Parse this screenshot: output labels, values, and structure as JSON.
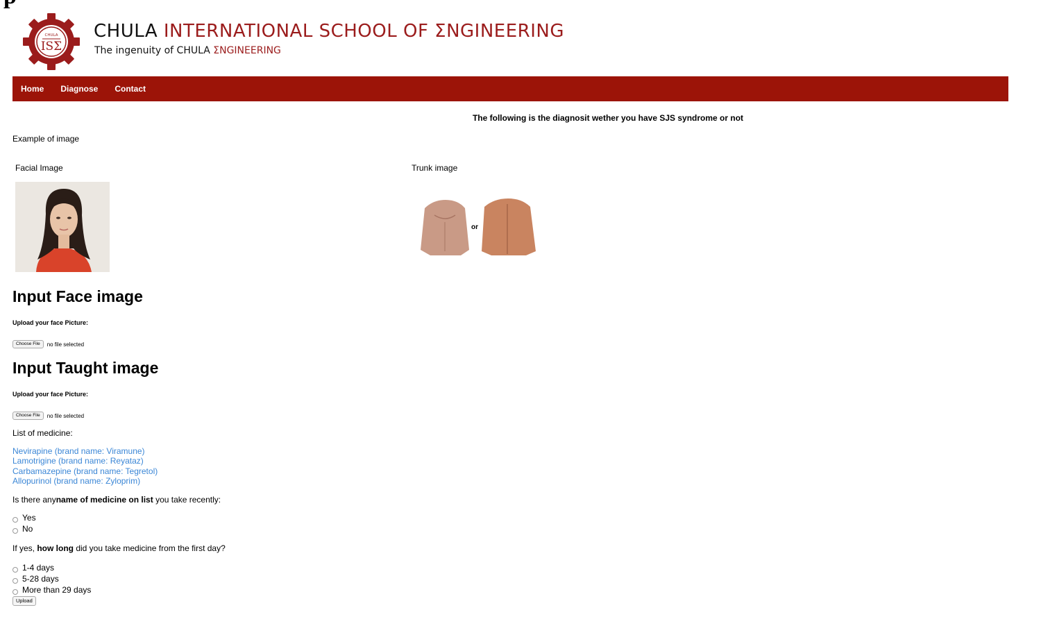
{
  "page_top_fragment": "p",
  "brand": {
    "logo_top_text": "CHULA",
    "logo_main_text": "ISΣ",
    "title_part1": "CHULA ",
    "title_part2": "INTERNATIONAL SCHOOL OF ΣNGINEERING",
    "subtitle_part1": "The ingenuity of CHULA ",
    "subtitle_part2": "ΣNGINEERING",
    "accent_color": "#9b1c1c"
  },
  "nav": {
    "background": "#9c1408",
    "items": [
      "Home",
      "Diagnose",
      "Contact"
    ]
  },
  "notice": "The following is the diagnosit wether you have SJS syndrome or not",
  "example_label": "Example of image",
  "facial_label": "Facial Image",
  "trunk_label": "Trunk image",
  "trunk_or": "or",
  "face_section": {
    "heading": "Input Face image",
    "upload_label": "Upload your face Picture:",
    "choose_button": "Choose File",
    "file_status": "no file selected"
  },
  "taught_section": {
    "heading": "Input Taught image",
    "upload_label": "Upload your face Picture:",
    "choose_button": "Choose File",
    "file_status": "no file selected"
  },
  "medicine": {
    "title": "List of medicine:",
    "items": [
      "Nevirapine (brand name: Viramune)",
      "Lamotrigine (brand name: Reyataz)",
      "Carbamazepine (brand name: Tegretol)",
      "Allopurinol (brand name: Zyloprim)"
    ]
  },
  "question1": {
    "prefix": "Is there any",
    "bold": "name of medicine on list",
    "suffix": " you take recently:",
    "options": [
      "Yes",
      "No"
    ]
  },
  "question2": {
    "prefix": "If yes, ",
    "bold": "how long",
    "suffix": " did you take medicine from the first day?",
    "options": [
      "1-4 days",
      "5-28 days",
      "More than 29 days"
    ]
  },
  "upload_button": "Upload"
}
